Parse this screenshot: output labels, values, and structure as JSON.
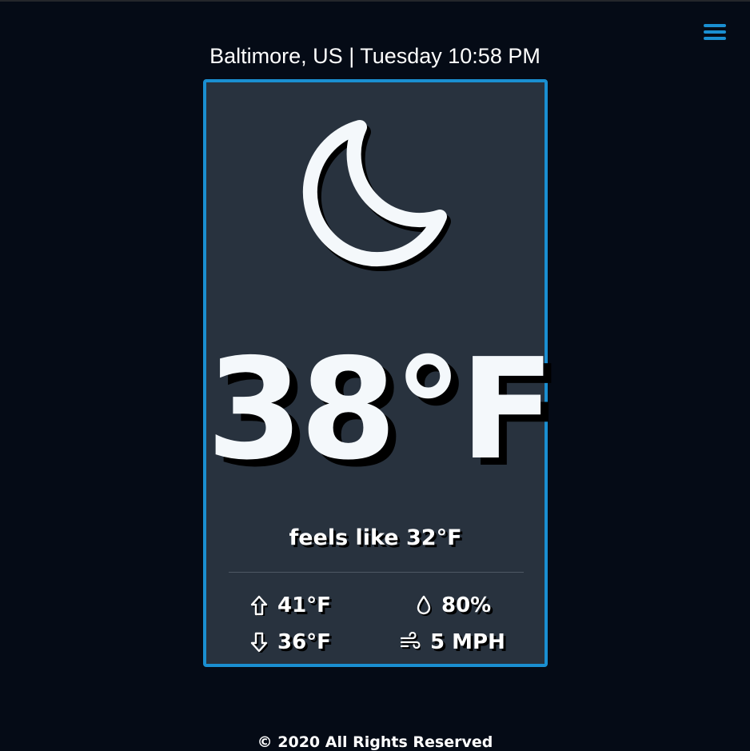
{
  "header": {
    "location_time": "Baltimore, US | Tuesday 10:58 PM",
    "menu_icon": "hamburger-menu-icon"
  },
  "weather": {
    "condition_icon": "moon-icon",
    "temperature": "38°F",
    "feels_like": "feels like 32°F",
    "high": "41°F",
    "low": "36°F",
    "humidity": "80%",
    "wind": "5 MPH",
    "icons": {
      "high": "arrow-up-icon",
      "low": "arrow-down-icon",
      "humidity": "water-drop-icon",
      "wind": "wind-icon"
    }
  },
  "footer": {
    "text": "© 2020 All Rights Reserved"
  },
  "colors": {
    "background": "#050b16",
    "card": "#28323e",
    "accent": "#1a8fd1",
    "text": "#f4f8fb"
  }
}
